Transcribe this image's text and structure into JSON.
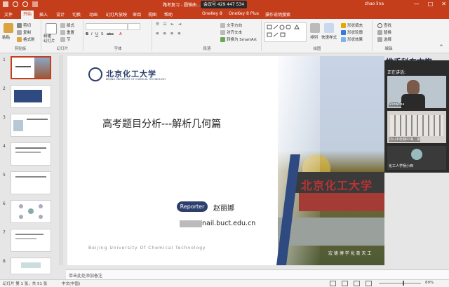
{
  "window": {
    "title": "路考复习 - 圆锥曲… - PowerPoint",
    "user": "zhao lina",
    "meeting_id": "会议号 429 447 534",
    "controls": [
      "—",
      "□",
      "✕"
    ]
  },
  "tabs": [
    "文件",
    "开始",
    "插入",
    "设计",
    "切换",
    "动画",
    "幻灯片放映",
    "审阅",
    "视图",
    "帮助",
    "OneKey 8",
    "OneKey 8 Plus",
    "操作说明搜索"
  ],
  "active_tab": "开始",
  "ribbon": {
    "clipboard": {
      "label": "剪贴板",
      "paste": "粘贴",
      "cut": "剪切",
      "copy": "复制",
      "format_painter": "格式刷"
    },
    "slides": {
      "label": "幻灯片",
      "new_slide": "新建\n幻灯片",
      "layout": "版式",
      "reset": "重置",
      "section": "节"
    },
    "font": {
      "label": "字体"
    },
    "paragraph": {
      "label": "段落",
      "text_direction": "文字方向",
      "align_text": "对齐文本",
      "smartart": "转换为 SmartArt"
    },
    "drawing": {
      "label": "绘图",
      "arrange": "排列",
      "quick_styles": "快速样式",
      "fill": "形状填充",
      "outline": "形状轮廓",
      "effects": "形状效果"
    },
    "editing": {
      "label": "编辑",
      "find": "查找",
      "replace": "替换",
      "select": "选择"
    }
  },
  "thumbnails": [
    "1",
    "2",
    "3",
    "4",
    "5",
    "6",
    "7",
    "8"
  ],
  "slide": {
    "logo_text": "北京化工大学",
    "logo_sub": "BEIJING UNIVERSITY OF CHEMICAL TECHNOLOGY",
    "title": "高考题目分析---解析几何篇",
    "reporter_badge": "Reporter",
    "reporter_name": "赵丽娜",
    "email_suffix": "nail.buct.edu.cn",
    "footer": "Beijing   University   Of   Chemical   Technology",
    "gate_text": "北京化工大学",
    "motto": "宏 德 博 学      化 育 天 工",
    "side_title": "推手科东中旗"
  },
  "panel": {
    "header": "正在讲话:",
    "tiles": [
      "SnowPea",
      "刘山中张静中海二楼",
      "化工人学杨小西"
    ]
  },
  "notes_placeholder": "单击此处添加备注",
  "status": {
    "slide_info": "幻灯片 第 1 张，共 51 张",
    "lang": "中文(中国)",
    "zoom": "89%"
  }
}
